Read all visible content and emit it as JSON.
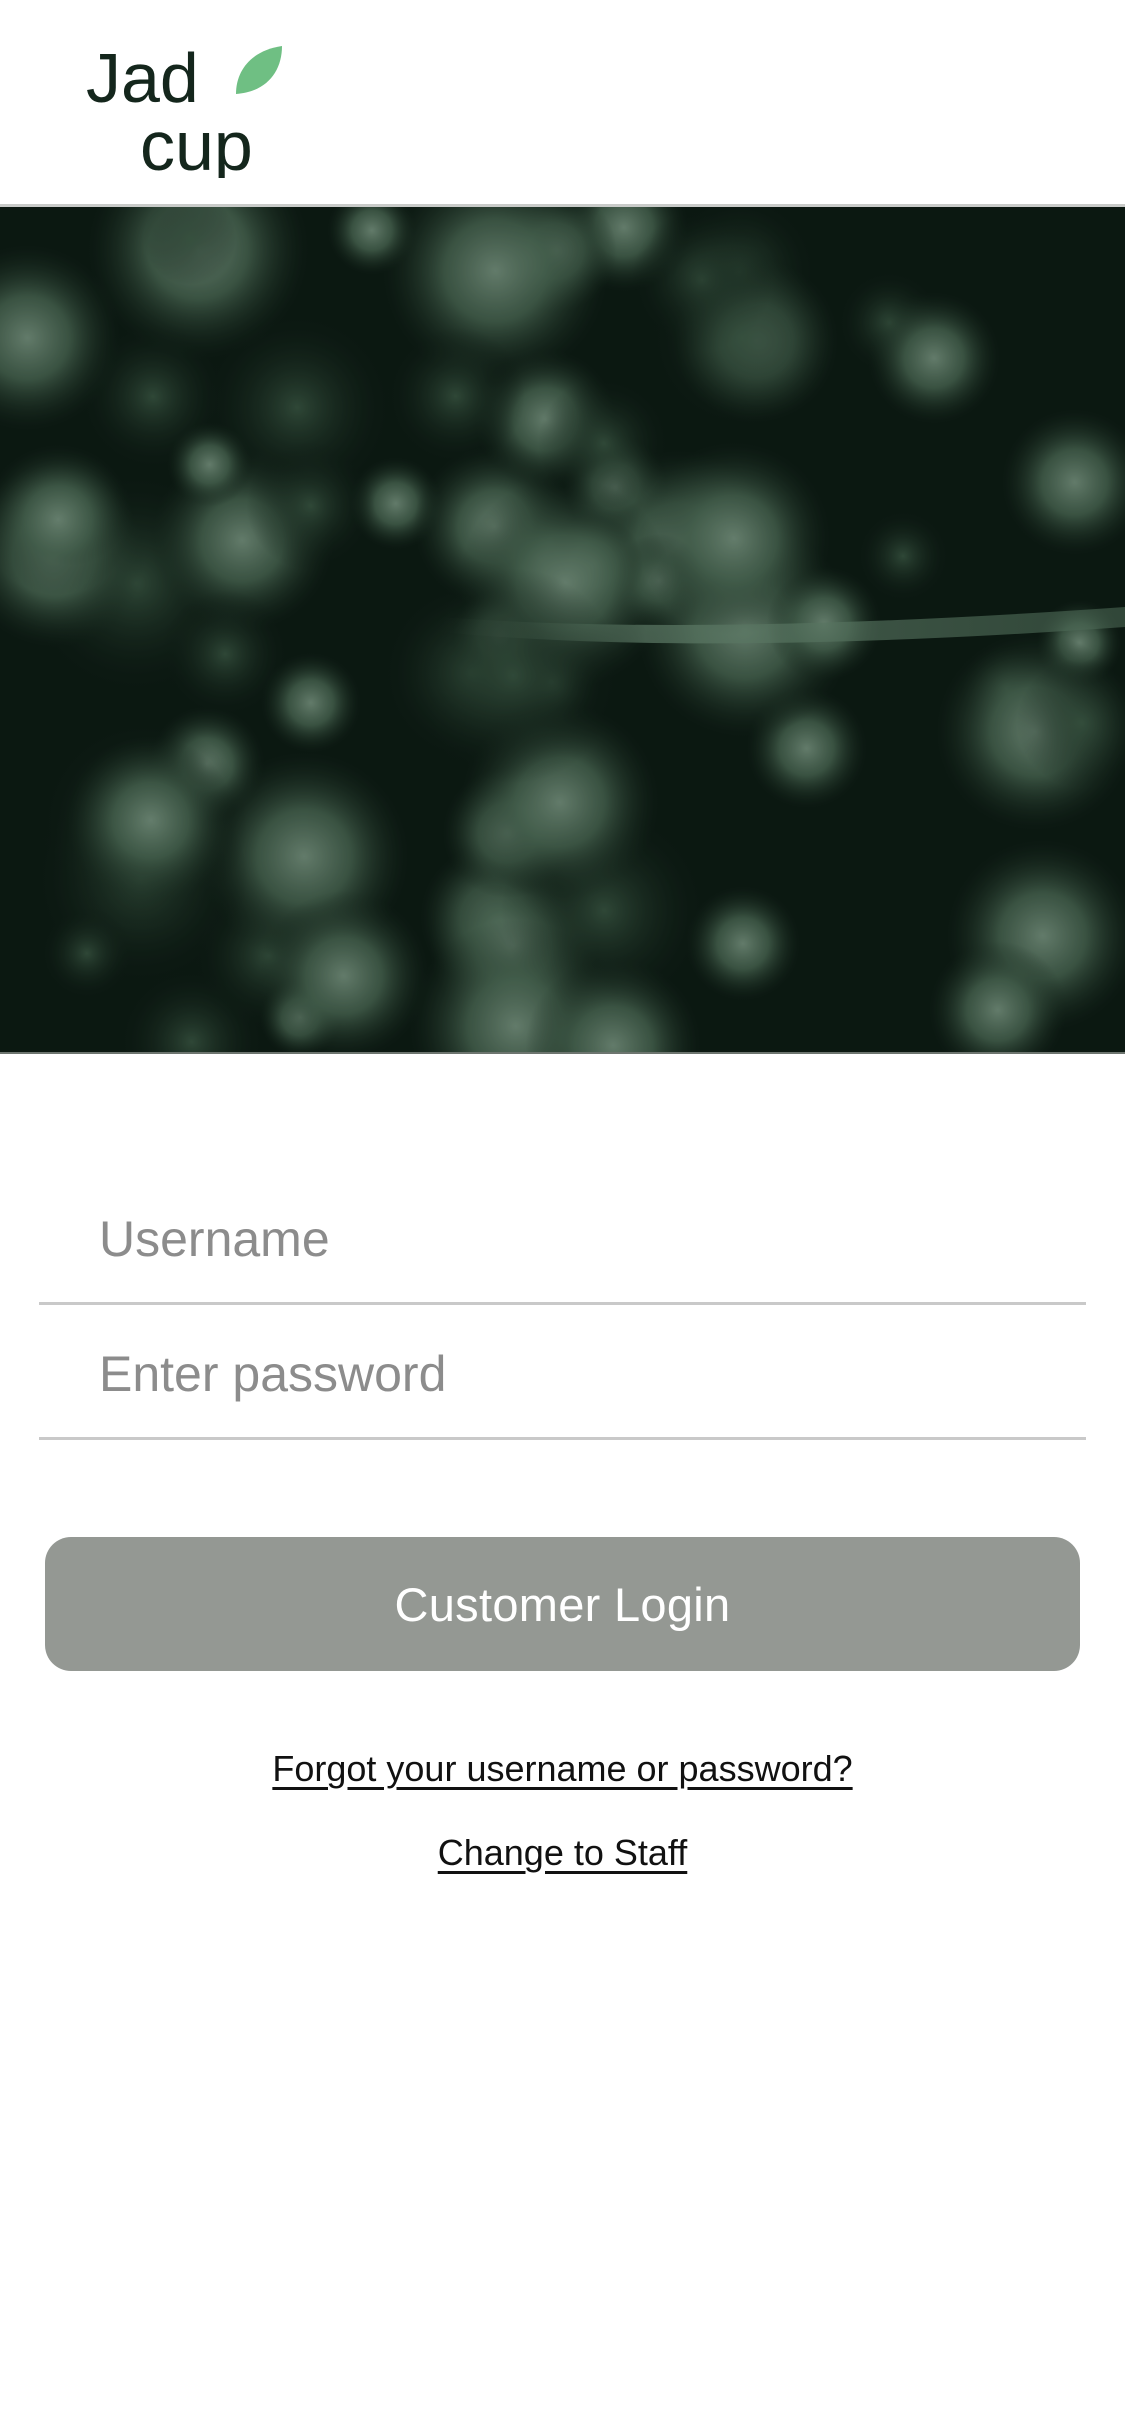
{
  "brand": {
    "name_line1": "Jad",
    "name_line2": "cup",
    "text_color": "#14261c",
    "leaf_color": "#6fbf83"
  },
  "form": {
    "username_placeholder": "Username",
    "password_placeholder": "Enter password",
    "login_label": "Customer Login"
  },
  "links": {
    "forgot": "Forgot your username or password?",
    "change_role": "Change to Staff"
  },
  "colors": {
    "button_bg": "#949893",
    "divider": "#c9c9c9",
    "placeholder": "#8c8c8c",
    "hero_dark": "#0d1a13",
    "hero_foliage": "#4f6d58"
  }
}
